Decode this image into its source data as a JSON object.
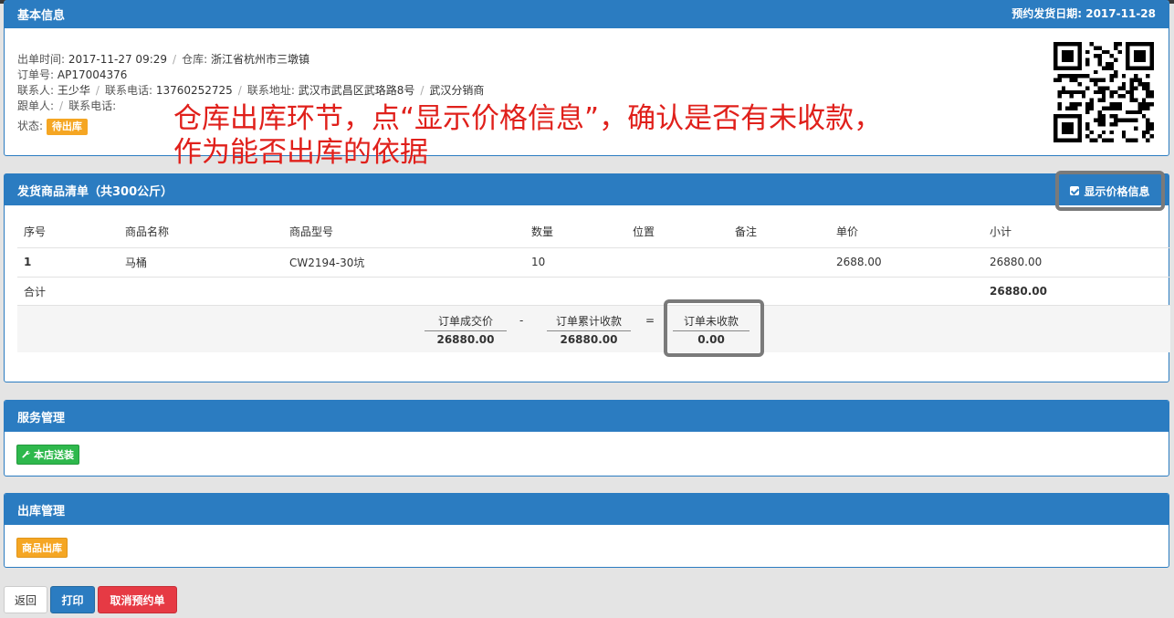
{
  "basic": {
    "title": "基本信息",
    "ship_date_label": "预约发货日期:",
    "ship_date": "2017-11-28",
    "issue_time_label": "出单时间:",
    "issue_time": "2017-11-27 09:29",
    "warehouse_label": "仓库:",
    "warehouse": "浙江省杭州市三墩镇",
    "order_no_label": "订单号:",
    "order_no": "AP17004376",
    "contact_label": "联系人:",
    "contact": "王少华",
    "phone_label": "联系电话:",
    "phone": "13760252725",
    "address_label": "联系地址:",
    "address": "武汉市武昌区武珞路8号",
    "distributor": "武汉分销商",
    "follower_label": "跟单人:",
    "follower_phone_label": "联系电话:",
    "status_label": "状态:",
    "status": "待出库"
  },
  "annotation": {
    "line1": "仓库出库环节，点“显示价格信息”，确认是否有未收款，",
    "line2": "作为能否出库的依据"
  },
  "goods": {
    "title": "发货商品清单（共300公斤）",
    "show_price_label": "显示价格信息",
    "show_price_checked": true,
    "columns": [
      "序号",
      "商品名称",
      "商品型号",
      "数量",
      "位置",
      "备注",
      "单价",
      "小计"
    ],
    "rows": [
      [
        "1",
        "马桶",
        "CW2194-30坑",
        "10",
        "",
        "",
        "2688.00",
        "26880.00"
      ]
    ],
    "total_label": "合计",
    "total": "26880.00",
    "summary": {
      "deal_label": "订单成交价",
      "deal_value": "26880.00",
      "minus": "-",
      "received_label": "订单累计收款",
      "received_value": "26880.00",
      "equals": "=",
      "unpaid_label": "订单未收款",
      "unpaid_value": "0.00"
    }
  },
  "service": {
    "title": "服务管理",
    "button": "本店送装",
    "button_icon": "wrench-icon"
  },
  "outbound": {
    "title": "出库管理",
    "button": "商品出库"
  },
  "footer": {
    "back": "返回",
    "print": "打印",
    "cancel": "取消预约单"
  },
  "colors": {
    "primary": "#2b7cc1",
    "annotation": "#e0201b",
    "orange": "#f5a623",
    "green": "#2eb84c",
    "danger": "#e63a44"
  }
}
